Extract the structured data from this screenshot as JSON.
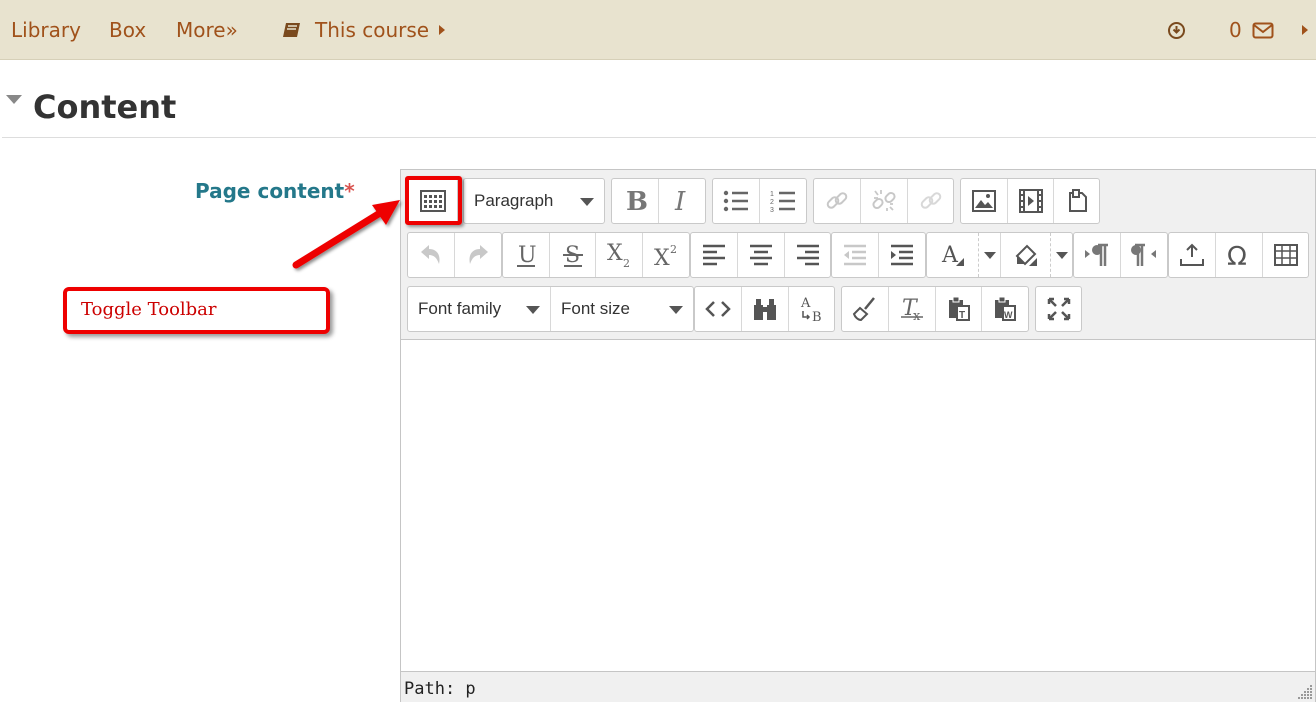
{
  "nav": {
    "links": [
      "Library",
      "Box",
      "More»"
    ],
    "course_label": "This course",
    "message_count": "0"
  },
  "section": {
    "title": "Content"
  },
  "field": {
    "label": "Page content",
    "required_mark": "*"
  },
  "editor": {
    "block_format": "Paragraph",
    "font_family": "Font family",
    "font_size": "Font size",
    "status_path": "Path: p",
    "icons_row1": [
      "toolbar-toggle-icon",
      "bold-icon",
      "italic-icon",
      "bullet-list-icon",
      "numbered-list-icon",
      "link-icon",
      "unlink-icon",
      "anchor-icon",
      "image-icon",
      "media-icon",
      "file-manager-icon"
    ],
    "icons_row2": [
      "undo-icon",
      "redo-icon",
      "underline-icon",
      "strikethrough-icon",
      "subscript-icon",
      "superscript-icon",
      "align-left-icon",
      "align-center-icon",
      "align-right-icon",
      "outdent-icon",
      "indent-icon",
      "text-color-icon",
      "background-color-icon",
      "ltr-icon",
      "rtl-icon",
      "upload-icon",
      "special-char-icon",
      "table-icon"
    ],
    "icons_row3": [
      "code-icon",
      "search-replace-icon",
      "spellcheck-icon",
      "clean-icon",
      "clear-format-icon",
      "paste-text-icon",
      "paste-word-icon",
      "fullscreen-icon"
    ]
  },
  "annotation": {
    "label": "Toggle Toolbar",
    "color": "#e00000"
  },
  "colors": {
    "nav_bg": "#e8e3cf",
    "nav_link": "#a0521b",
    "label": "#24788a"
  }
}
